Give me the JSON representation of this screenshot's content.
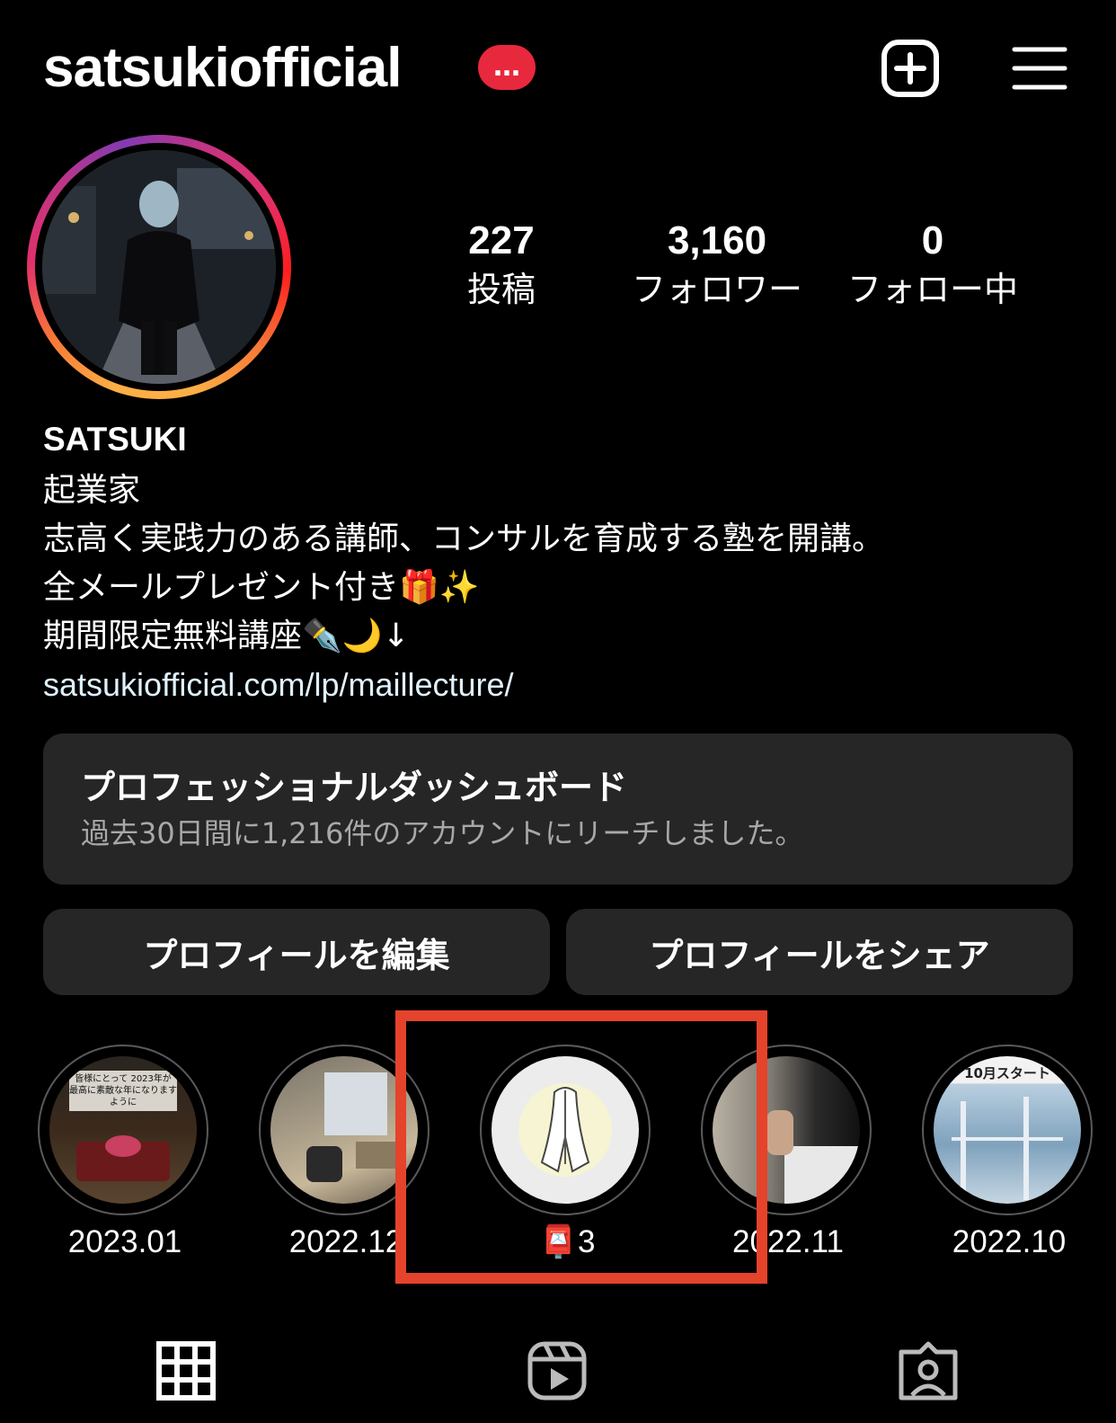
{
  "header": {
    "username": "satsukiofficial",
    "badge": "…"
  },
  "stats": [
    {
      "value": "227",
      "label": "投稿"
    },
    {
      "value": "3,160",
      "label": "フォロワー"
    },
    {
      "value": "0",
      "label": "フォロー中"
    }
  ],
  "bio": {
    "name": "SATSUKI",
    "line1": "起業家",
    "line2": "志高く実践力のある講師、コンサルを育成する塾を開講。",
    "line3": "全メールプレゼント付き🎁✨",
    "line4": "期間限定無料講座✒️🌙↓",
    "link": "satsukiofficial.com/lp/maillecture/"
  },
  "dashboard": {
    "title": "プロフェッショナルダッシュボード",
    "subtitle": "過去30日間に1,216件のアカウントにリーチしました。"
  },
  "buttons": {
    "edit": "プロフィールを編集",
    "share": "プロフィールをシェア"
  },
  "highlights": [
    {
      "label": "2023.01",
      "thumb_text": "皆様にとって 2023年が 最高に素敵な年になりますように"
    },
    {
      "label": "2022.12"
    },
    {
      "label": "📮3"
    },
    {
      "label": "2022.11"
    },
    {
      "label": "2022.10",
      "thumb_text": "10月スタート"
    }
  ],
  "tabs": [
    "grid-icon",
    "reels-icon",
    "tagged-icon"
  ],
  "colors": {
    "background": "#000000",
    "card": "#262626",
    "badge": "#e8283d",
    "highlight_box": "#e5432b",
    "link": "#e0f1ff"
  }
}
